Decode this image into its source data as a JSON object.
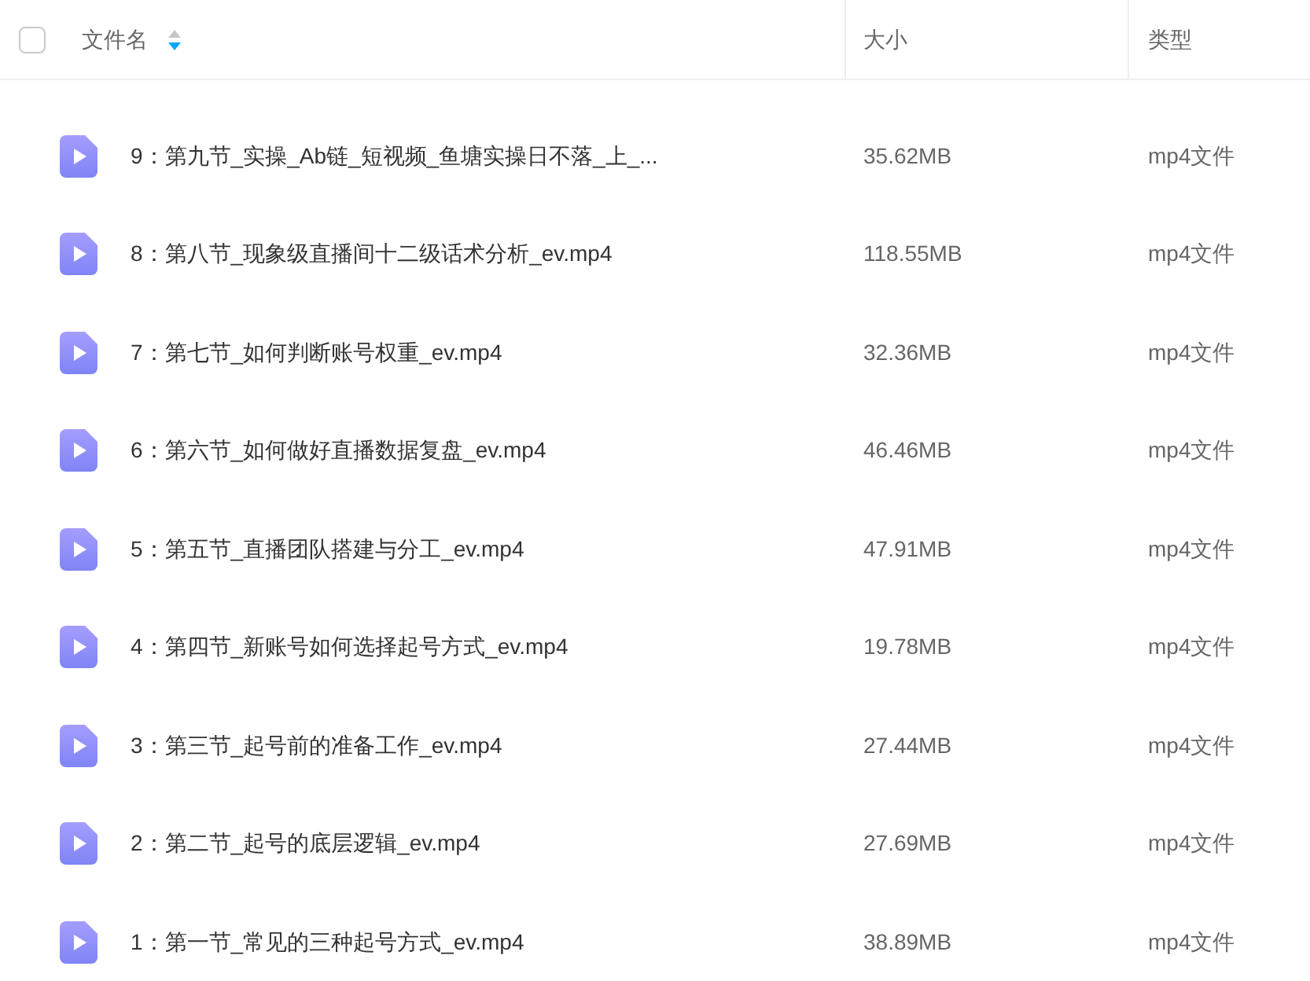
{
  "header": {
    "select_all": {
      "checked": false
    },
    "columns": [
      {
        "label": "文件名",
        "sorted_descending": true
      },
      {
        "label": "大小"
      },
      {
        "label": "类型"
      }
    ]
  },
  "files": [
    {
      "name": "9：第九节_实操_Ab链_短视频_鱼塘实操日不落_上_...",
      "size": "35.62MB",
      "type": "mp4文件"
    },
    {
      "name": "8：第八节_现象级直播间十二级话术分析_ev.mp4",
      "size": "118.55MB",
      "type": "mp4文件"
    },
    {
      "name": "7：第七节_如何判断账号权重_ev.mp4",
      "size": "32.36MB",
      "type": "mp4文件"
    },
    {
      "name": "6：第六节_如何做好直播数据复盘_ev.mp4",
      "size": "46.46MB",
      "type": "mp4文件"
    },
    {
      "name": "5：第五节_直播团队搭建与分工_ev.mp4",
      "size": "47.91MB",
      "type": "mp4文件"
    },
    {
      "name": "4：第四节_新账号如何选择起号方式_ev.mp4",
      "size": "19.78MB",
      "type": "mp4文件"
    },
    {
      "name": "3：第三节_起号前的准备工作_ev.mp4",
      "size": "27.44MB",
      "type": "mp4文件"
    },
    {
      "name": "2：第二节_起号的底层逻辑_ev.mp4",
      "size": "27.69MB",
      "type": "mp4文件"
    },
    {
      "name": "1：第一节_常见的三种起号方式_ev.mp4",
      "size": "38.89MB",
      "type": "mp4文件"
    }
  ]
}
